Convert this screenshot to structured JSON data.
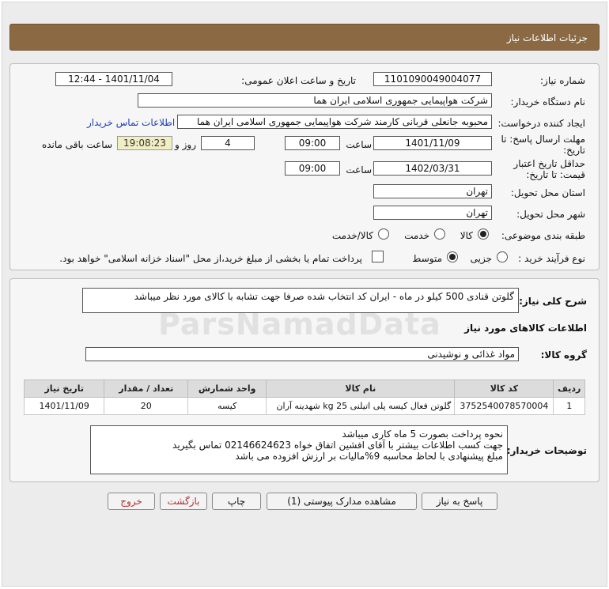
{
  "header": {
    "title": "جزئیات اطلاعات نیاز"
  },
  "form": {
    "need_number": {
      "label": "شماره نیاز:",
      "value": "1101090049004077"
    },
    "announce_datetime": {
      "label": "تاریخ و ساعت اعلان عمومی:",
      "value": "1401/11/04 - 12:44"
    },
    "buyer_org": {
      "label": "نام دستگاه خریدار:",
      "value": "شرکت هواپیمایی جمهوری اسلامی ایران هما"
    },
    "requester": {
      "label": "ایجاد کننده درخواست:",
      "value": "محبوبه جانعلی قربانی کارمند شرکت هواپیمایی جمهوری اسلامی ایران هما"
    },
    "buyer_contact_link": "اطلاعات تماس خریدار",
    "reply_deadline": {
      "label_line1": "مهلت ارسال پاسخ: تا",
      "label_line2": "تاریخ:",
      "date": "1401/11/09",
      "time_label": "ساعت",
      "time": "09:00",
      "days": "4",
      "days_label": "روز و",
      "remaining": "19:08:23",
      "remaining_label": "ساعت باقی مانده"
    },
    "price_validity": {
      "label_line1": "حداقل تاریخ اعتبار",
      "label_line2": "قیمت: تا تاریخ:",
      "date": "1402/03/31",
      "time_label": "ساعت",
      "time": "09:00"
    },
    "delivery_province": {
      "label": "استان محل تحویل:",
      "value": "تهران"
    },
    "delivery_city": {
      "label": "شهر محل تحویل:",
      "value": "تهران"
    },
    "category": {
      "label": "طبقه بندی موضوعی:",
      "options": [
        "کالا",
        "خدمت",
        "کالا/خدمت"
      ],
      "selected": "کالا"
    },
    "process_type": {
      "label": "نوع فرآیند خرید :",
      "options": [
        "جزیی",
        "متوسط"
      ],
      "selected": "متوسط",
      "treasury_note": "پرداخت تمام یا بخشی از مبلغ خرید،از محل \"اسناد خزانه اسلامی\" خواهد بود."
    }
  },
  "summary": {
    "label": "شرح کلی نیاز:",
    "text": "گلوتن قنادی 500 کیلو در ماه - ایران کد انتخاب شده صرفا جهت تشابه با کالای مورد نظر میباشد"
  },
  "goods_section": {
    "title": "اطلاعات کالاهای مورد نیاز",
    "group_label": "گروه کالا:",
    "group_value": "مواد غذائی و نوشیدنی"
  },
  "table": {
    "headers": [
      "ردیف",
      "کد کالا",
      "نام کالا",
      "واحد شمارش",
      "تعداد / مقدار",
      "تاریخ نیاز"
    ],
    "rows": [
      [
        "1",
        "3752540078570004",
        "گلوتن فعال کیسه پلی اتیلنی kg 25 شهدینه آران",
        "کیسه",
        "20",
        "1401/11/09"
      ]
    ]
  },
  "buyer_notes": {
    "label": "توضیحات خریدار:",
    "lines": [
      "نحوه پرداخت بصورت 5 ماه کاری میباشد",
      "جهت کسب اطلاعات بیشتر با آقای افشین اتفاق خواه  02146624623 تماس بگیرید",
      "مبلغ پیشنهادی با لحاظ محاسبه 9%مالیات بر ارزش افزوده می باشد"
    ]
  },
  "buttons": {
    "reply": "پاسخ به نیاز",
    "attachments": "مشاهده مدارک پیوستی (1)",
    "print": "چاپ",
    "back": "بازگشت",
    "exit": "خروج"
  },
  "watermark": "ParsNamadData"
}
